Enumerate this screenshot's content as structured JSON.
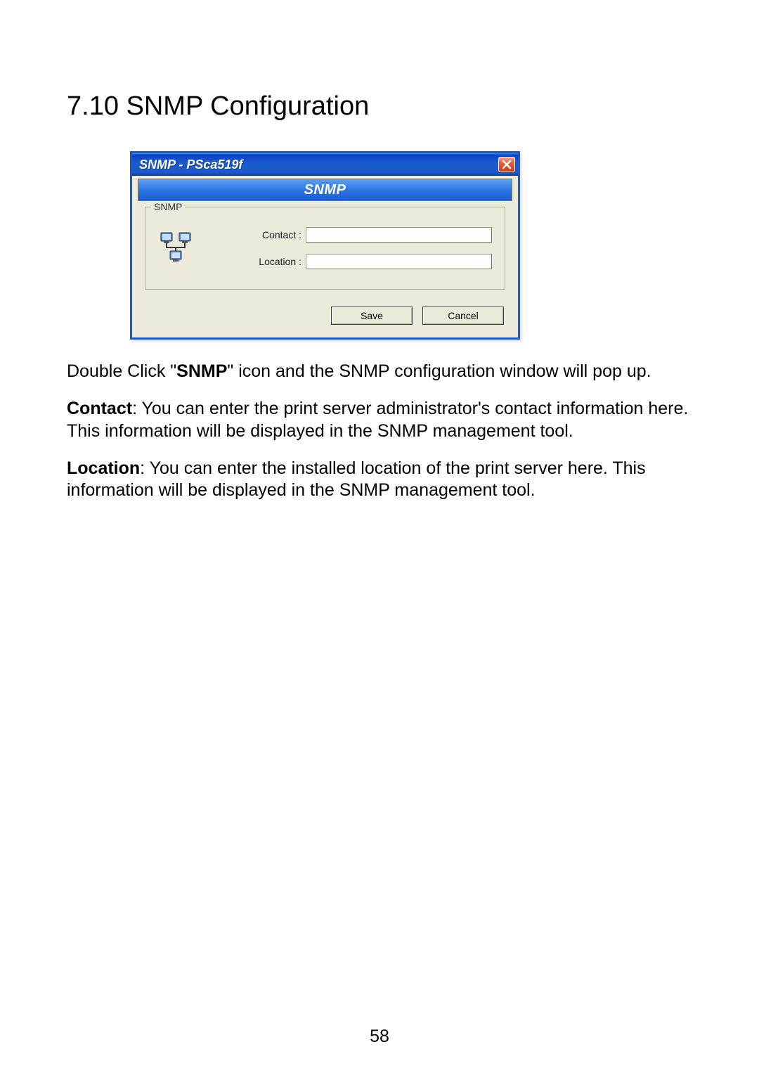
{
  "heading": "7.10   SNMP Configuration",
  "dialog": {
    "title": "SNMP - PSca519f",
    "banner": "SNMP",
    "group_legend": "SNMP",
    "fields": {
      "contact_label": "Contact :",
      "contact_value": "",
      "location_label": "Location :",
      "location_value": ""
    },
    "buttons": {
      "save": "Save",
      "cancel": "Cancel"
    }
  },
  "paragraphs": {
    "p1_pre": "Double Click \"",
    "p1_bold": "SNMP",
    "p1_post": "\" icon and the SNMP configuration window will pop up.",
    "p2_bold": "Contact",
    "p2_rest": ": You can enter the print server administrator's contact information here. This information will be displayed in the SNMP management tool.",
    "p3_bold": "Location",
    "p3_rest": ": You can enter the installed location of the print server here. This information will be displayed in the SNMP management tool."
  },
  "page_number": "58"
}
